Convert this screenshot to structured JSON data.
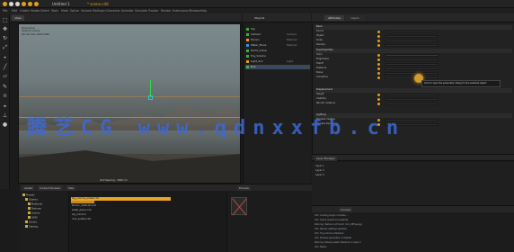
{
  "window": {
    "title_left": "Untitled 1",
    "title_right": "* scene.c4d",
    "menu": [
      "File",
      "Edit",
      "Create",
      "Modes",
      "Select",
      "Tools",
      "Mesh",
      "Spline",
      "Volume",
      "MoGraph",
      "Character",
      "Animate",
      "Simulate",
      "Tracker",
      "Render",
      "Extensions",
      "Window",
      "Help"
    ]
  },
  "viewport": {
    "tab": "View",
    "info_lines": [
      "Perspective",
      "Default Camera",
      "Render Size 1920x1080"
    ],
    "footer": "Grid Spacing : 1000 cm"
  },
  "object_manager": {
    "title": "Objects",
    "items": [
      {
        "name": "Sky",
        "tag": "",
        "color": "green"
      },
      {
        "name": "Camera",
        "tag": "Camera",
        "color": "green"
      },
      {
        "name": "Terrain",
        "tag": "Material",
        "color": "orange"
      },
      {
        "name": "Water_Plane",
        "tag": "Material",
        "color": "blue"
      },
      {
        "name": "Rocks_Group",
        "tag": "",
        "color": "green"
      },
      {
        "name": "Fog_Volume",
        "tag": "",
        "color": "green"
      },
      {
        "name": "Light_Sun",
        "tag": "Light",
        "color": "orange"
      },
      {
        "name": "Null",
        "tag": "",
        "color": "green",
        "selected": true
      }
    ]
  },
  "attributes": {
    "tab_primary": "Attributes",
    "tab_secondary": "Layers",
    "rows": [
      {
        "label": "Basic",
        "section": true
      },
      {
        "label": "Coord.",
        "section": false
      },
      {
        "label": "Object",
        "section": false
      },
      {
        "label": "Scale",
        "section": false
      },
      {
        "label": "Density",
        "section": false
      },
      {
        "label": "Fog Properties",
        "section": true
      },
      {
        "label": "Color",
        "section": false
      },
      {
        "label": "Brightness",
        "section": false
      },
      {
        "label": "Falloff",
        "section": false
      },
      {
        "label": "Distance",
        "section": false
      },
      {
        "label": "Noise",
        "section": false
      },
      {
        "label": "Animation",
        "section": false
      },
      {
        "label": "Displacement",
        "section": true
      },
      {
        "label": "Height",
        "section": false
      },
      {
        "label": "Visibility",
        "section": false
      },
      {
        "label": "Render Instance",
        "section": false
      },
      {
        "label": "Lighting",
        "section": true
      },
      {
        "label": "Shadow Casting",
        "section": false
      },
      {
        "label": "Shadow Receiving",
        "section": false
      }
    ],
    "tooltip": "Click to open the parameter dialog for the selected object"
  },
  "layers_panel": {
    "title": "Layer Manager",
    "rows": [
      "Layer 1",
      "Layer 2",
      "Layer 3"
    ]
  },
  "bottom_left": {
    "tabs": [
      "Assets",
      "Content Browser",
      "Take"
    ],
    "tree": [
      "Presets",
      "Objects",
      "Materials",
      "Textures",
      "Scenes",
      "HDRI",
      "Library",
      "Catalog"
    ],
    "assets": [
      "fog_volume_preset.c4d",
      "terrain_material.mat",
      "water_plane.c4d",
      "sky_hdri.hdr",
      "rock_scatter.c4d"
    ]
  },
  "preview": {
    "title": "Preview"
  },
  "console": {
    "title": "Console",
    "lines": [
      "Info: Loading plugin modules ...",
      "Info: Scene loaded successfully",
      "Warning: Texture not found: rock_diffuse.jpg",
      "Info: Render settings updated",
      "Info: Fog volume initialized",
      "Info: Preview generation complete",
      "Warning: Missing asset reference in layer 2",
      "Info: Ready"
    ]
  },
  "watermark": "腾艺CG www.qdnxxfb.cn",
  "colors": {
    "accent": "#e39c1c",
    "watermark": "#3b69d8"
  }
}
